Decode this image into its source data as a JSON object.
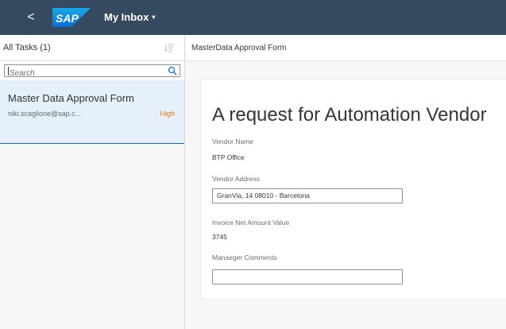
{
  "shellbar": {
    "back_symbol": "<",
    "logo_text": "SAP",
    "app_title": "My Inbox",
    "app_title_caret": "▾",
    "color": "#354a5f"
  },
  "master": {
    "title": "All Tasks (1)",
    "search": {
      "placeholder": "Search"
    },
    "items": [
      {
        "title": "Master Data Approval Form",
        "user": "niki.scaglione@sap.c...",
        "priority": "High",
        "priority_color": "#e9730c"
      }
    ]
  },
  "detail": {
    "title": "MasterData Approval Form",
    "heading": "A request for Automation Vendor",
    "fields": [
      {
        "label": "Vendor Name",
        "value": "BTP Office",
        "type": "text"
      },
      {
        "label": "Vendor Address",
        "value": "GranVia, 14 08010 - Barcelona",
        "type": "input"
      },
      {
        "label": "Invoice Net Amount Value",
        "value": "3745",
        "type": "text"
      },
      {
        "label": "Manaeger Comments",
        "value": "",
        "type": "input"
      }
    ]
  }
}
